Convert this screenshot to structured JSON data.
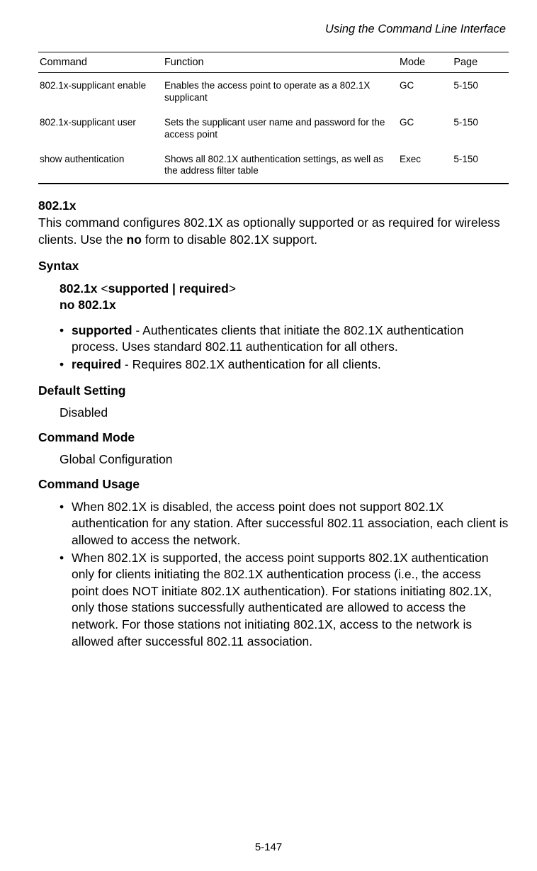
{
  "header": {
    "title": "Using the Command Line Interface"
  },
  "table": {
    "headers": {
      "command": "Command",
      "function": "Function",
      "mode": "Mode",
      "page": "Page"
    },
    "rows": [
      {
        "command": "802.1x-supplicant enable",
        "function": "Enables the access point to operate as a 802.1X supplicant",
        "mode": "GC",
        "page": "5-150"
      },
      {
        "command": "802.1x-supplicant user",
        "function": "Sets the supplicant user name and password for the access point",
        "mode": "GC",
        "page": "5-150"
      },
      {
        "command": "show authentication",
        "function": "Shows all 802.1X authentication settings, as well as the address filter table",
        "mode": "Exec",
        "page": "5-150"
      }
    ]
  },
  "section": {
    "title": "802.1x",
    "intro_before_no": "This command configures 802.1X as optionally supported or as required for wireless clients. Use the ",
    "intro_no": "no",
    "intro_after_no": " form to disable 802.1X support."
  },
  "syntax": {
    "heading": "Syntax",
    "line1_bold1": "802.1x",
    "line1_mid": " <",
    "line1_bold2": "supported | required",
    "line1_end": ">",
    "line2": "no 802.1x",
    "bullets": [
      {
        "bold": "supported",
        "text": " - Authenticates clients that initiate the 802.1X authentication process. Uses standard 802.11 authentication for all others."
      },
      {
        "bold": "required",
        "text": " - Requires 802.1X authentication for all clients."
      }
    ]
  },
  "default_setting": {
    "heading": "Default Setting",
    "value": "Disabled"
  },
  "command_mode": {
    "heading": "Command Mode",
    "value": "Global Configuration"
  },
  "command_usage": {
    "heading": "Command Usage",
    "bullets": [
      "When 802.1X is disabled, the access point does not support 802.1X authentication for any station. After successful 802.11 association, each client is allowed to access the network.",
      "When 802.1X is supported, the access point supports 802.1X authentication only for clients initiating the 802.1X authentication process (i.e., the access point does NOT initiate 802.1X authentication). For stations initiating 802.1X, only those stations successfully authenticated are allowed to access the network. For those stations not initiating 802.1X, access to the network is allowed after successful 802.11 association."
    ]
  },
  "footer": {
    "page": "5-147"
  }
}
